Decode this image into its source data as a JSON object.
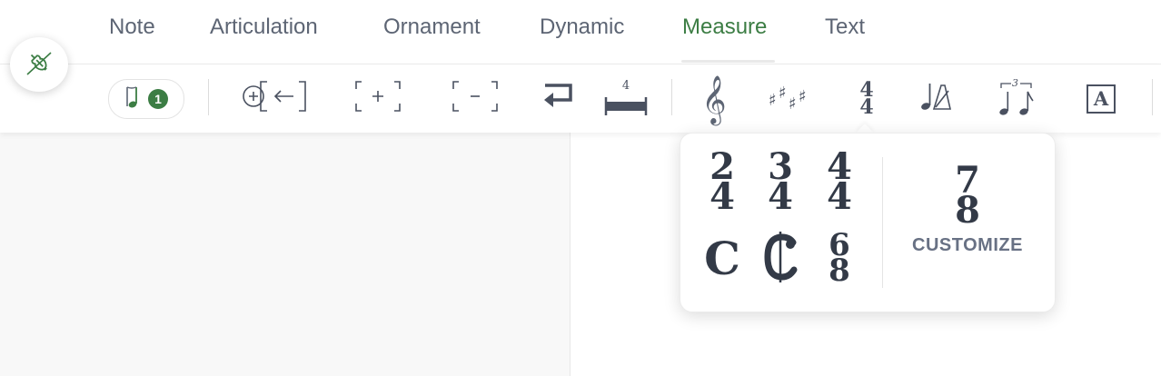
{
  "tabs": [
    {
      "label": "Note"
    },
    {
      "label": "Articulation"
    },
    {
      "label": "Ornament"
    },
    {
      "label": "Dynamic"
    },
    {
      "label": "Measure",
      "active": true
    },
    {
      "label": "Text"
    }
  ],
  "toolbar": {
    "voice_count": "1",
    "measure_rest_count": "4",
    "time_signature": {
      "top": "4",
      "bottom": "4"
    },
    "tuplet_number": "3",
    "text_box_letter": "A"
  },
  "time_signature_popover": {
    "options": [
      {
        "top": "2",
        "bottom": "4"
      },
      {
        "top": "3",
        "bottom": "4"
      },
      {
        "top": "4",
        "bottom": "4"
      },
      {
        "symbol": "C"
      },
      {
        "symbol": "C|"
      },
      {
        "top": "6",
        "bottom": "8"
      }
    ],
    "custom_preview": {
      "top": "7",
      "bottom": "8"
    },
    "custom_label": "CUSTOMIZE"
  },
  "colors": {
    "accent": "#3c7d44",
    "text": "#5d6574",
    "glyph": "#333a47"
  }
}
